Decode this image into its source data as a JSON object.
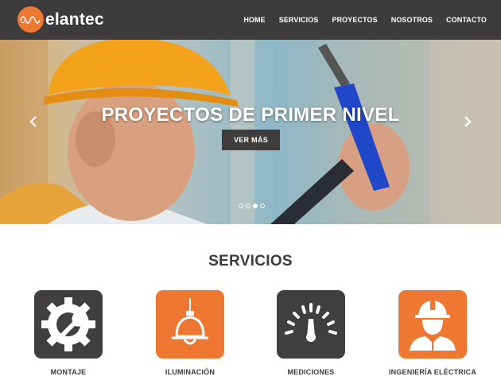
{
  "brand": {
    "name": "elantec",
    "accent": "#ee7832",
    "dark": "#3d3b3c"
  },
  "nav": {
    "items": [
      "HOME",
      "SERVICIOS",
      "PROYECTOS",
      "NOSOTROS",
      "CONTACTO"
    ]
  },
  "hero": {
    "title": "PROYECTOS DE PRIMER NIVEL",
    "button": "VER MÁS",
    "prev_icon": "chevron-left-icon",
    "next_icon": "chevron-right-icon",
    "slides": 4,
    "active_slide": 3
  },
  "services": {
    "title": "SERVICIOS",
    "items": [
      {
        "label": "MONTAJE",
        "icon": "gear-wrench-icon",
        "color": "#403e3e"
      },
      {
        "label": "ILUMINACIÓN",
        "icon": "lamp-icon",
        "color": "#ee7832"
      },
      {
        "label": "MEDICIONES",
        "icon": "gauge-icon",
        "color": "#403e3e"
      },
      {
        "label": "INGENIERÍA ELÉCTRICA",
        "icon": "engineer-icon",
        "color": "#ee7832"
      }
    ]
  }
}
